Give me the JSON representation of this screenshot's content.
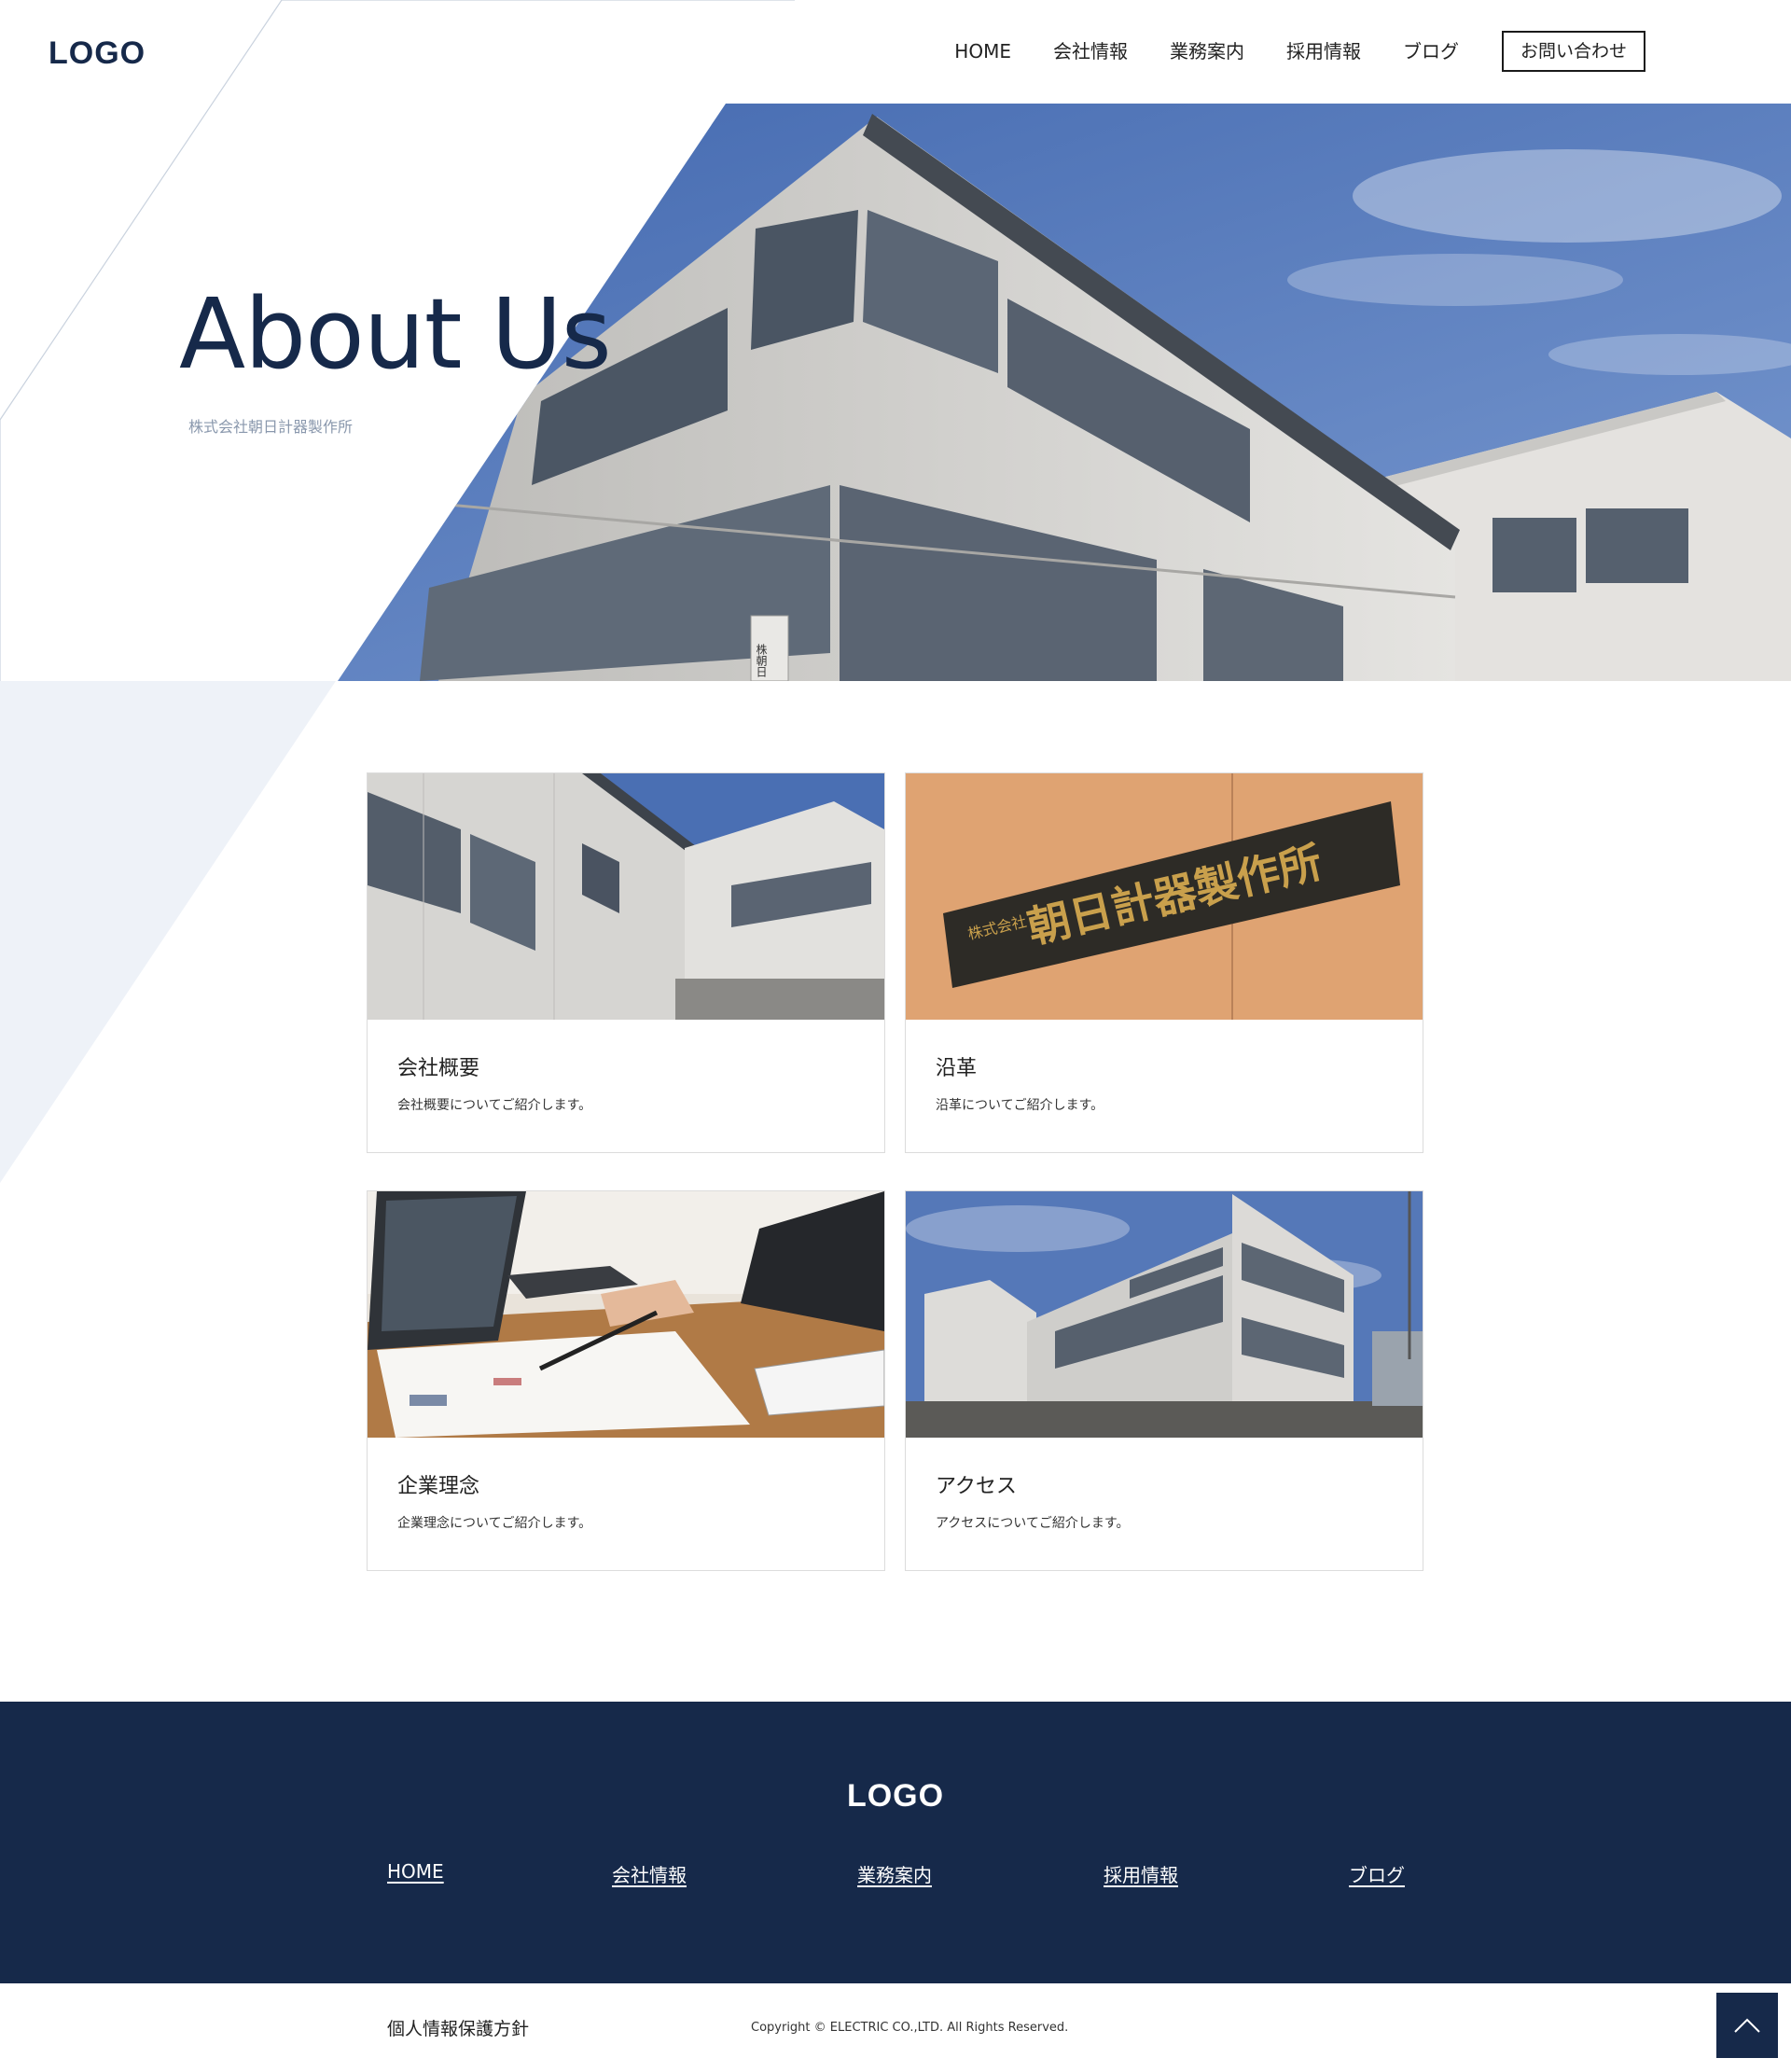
{
  "header": {
    "logo": "LOGO",
    "nav": [
      "HOME",
      "会社情報",
      "業務案内",
      "採用情報",
      "ブログ"
    ],
    "contact_button": "お問い合わせ"
  },
  "hero": {
    "title": "About Us",
    "subtitle": "株式会社朝日計器製作所",
    "sign_text": "株朝日"
  },
  "cards": [
    {
      "title": "会社概要",
      "description": "会社概要についてご紹介します。",
      "image": "building-side-photo"
    },
    {
      "title": "沿革",
      "description": "沿革についてご紹介します。",
      "image": "company-nameplate-photo",
      "sign_small": "株式会社",
      "sign_large": "朝日計器製作所"
    },
    {
      "title": "企業理念",
      "description": "企業理念についてご紹介します。",
      "image": "business-meeting-photo"
    },
    {
      "title": "アクセス",
      "description": "アクセスについてご紹介します。",
      "image": "building-exterior-photo"
    }
  ],
  "footer": {
    "logo": "LOGO",
    "nav": [
      "HOME",
      "会社情報",
      "業務案内",
      "採用情報",
      "ブログ"
    ],
    "privacy": "個人情報保護方針",
    "copyright": "Copyright © ELECTRIC CO.,LTD. All Rights Reserved."
  },
  "colors": {
    "navy": "#16294a",
    "sky": "#4a72b8",
    "wall": "#d9d9d7",
    "accent_gray": "#8a98ad"
  },
  "icons": {
    "to_top": "chevron-up-icon"
  }
}
